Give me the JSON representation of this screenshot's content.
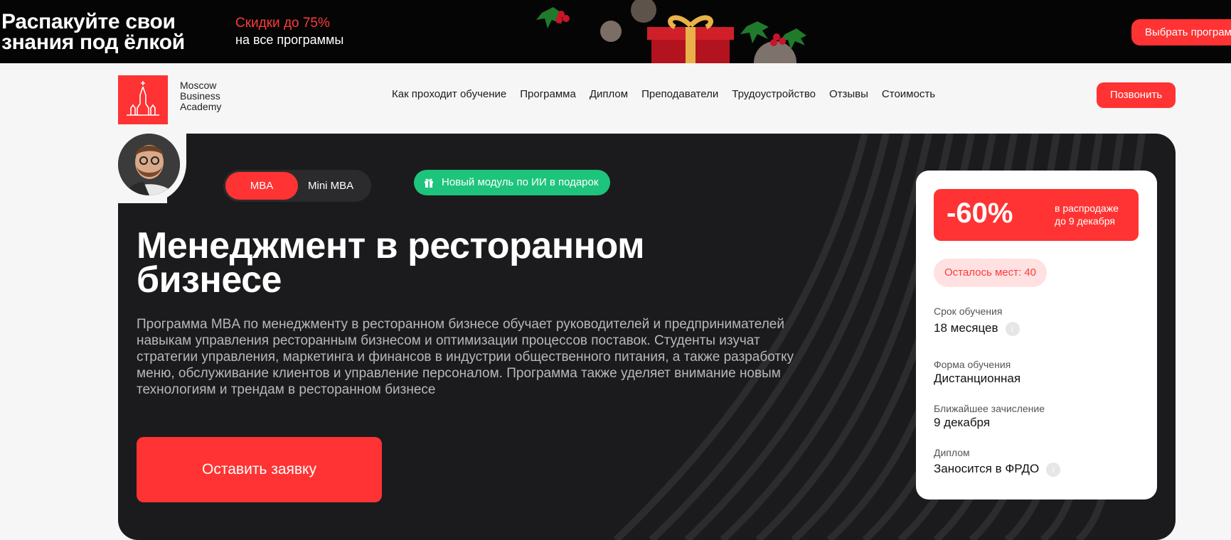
{
  "promo": {
    "title_line1": "Распакуйте свои",
    "title_line2": "знания под ёлкой",
    "sale": "Скидки до 75%",
    "sub": "на все программы",
    "button": "Выбрать программу"
  },
  "header": {
    "brand_line1": "Moscow",
    "brand_line2": "Business",
    "brand_line3": "Academy",
    "nav": [
      "Как проходит обучение",
      "Программа",
      "Диплом",
      "Преподаватели",
      "Трудоустройство",
      "Отзывы",
      "Стоимость"
    ],
    "call_button": "Позвонить"
  },
  "hero": {
    "toggle_active": "MBA",
    "toggle_other": "Mini MBA",
    "badge": "Новый модуль по ИИ в подарок",
    "title": "Менеджмент в ресторанном бизнесе",
    "description": "Программа MBA по менеджменту в ресторанном бизнесе обучает руководителей и предпринимателей навыкам управления ресторанным бизнесом и оптимизации процессов поставок. Студенты изучат стратегии управления, маркетинга и финансов в индустрии общественного питания, а также разработку меню, обслуживание клиентов и управление персоналом. Программа также уделяет внимание новым технологиям и трендам в ресторанном бизнесе",
    "apply_button": "Оставить заявку"
  },
  "card": {
    "discount": "-60%",
    "discount_note1": "в распродаже",
    "discount_note2": "до 9 декабря",
    "seats": "Осталось мест: 40",
    "duration_label": "Срок обучения",
    "duration_value": "18 месяцев",
    "format_label": "Форма обучения",
    "format_value": "Дистанционная",
    "enroll_label": "Ближайшее зачисление",
    "enroll_value": "9 декабря",
    "diploma_label": "Диплом",
    "diploma_value": "Заносится в ФРДО",
    "info_glyph": "i"
  },
  "colors": {
    "accent": "#ff3333",
    "green": "#1ec47c",
    "dark": "#1b1b1d"
  }
}
